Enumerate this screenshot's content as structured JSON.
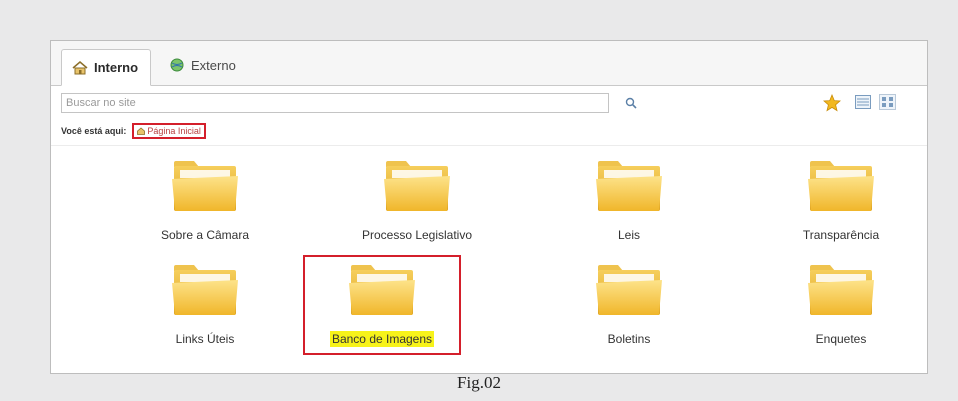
{
  "tabs": [
    {
      "label": "Interno",
      "icon": "home-icon",
      "active": true
    },
    {
      "label": "Externo",
      "icon": "globe-icon",
      "active": false
    }
  ],
  "search": {
    "placeholder": "Buscar no site"
  },
  "toolbar": {
    "favorite_icon": "star-icon",
    "list_view_icon": "list-view-icon",
    "icon_view_icon": "icon-view-icon"
  },
  "breadcrumb": {
    "label": "Você está aqui:",
    "current": "Página Inicial"
  },
  "folders": [
    {
      "label": "Sobre a Câmara"
    },
    {
      "label": "Processo Legislativo"
    },
    {
      "label": "Leis"
    },
    {
      "label": "Transparência"
    },
    {
      "label": "Links Úteis"
    },
    {
      "label": "Banco de Imagens",
      "highlighted": true
    },
    {
      "label": "Boletins"
    },
    {
      "label": "Enquetes"
    }
  ],
  "caption": "Fig.02",
  "colors": {
    "highlight_border": "#d41f2b",
    "highlight_text_bg": "#f7f31a",
    "folder": "#f5c53a"
  }
}
